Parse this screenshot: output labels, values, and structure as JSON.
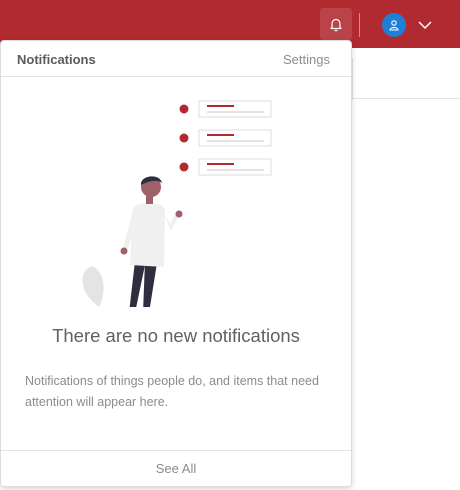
{
  "topbar": {
    "color": "#b02a30",
    "bell_icon": "bell-icon",
    "user_icon": "user-icon",
    "chevron_icon": "chevron-down-icon",
    "avatar_color": "#1f7ed6"
  },
  "notifications": {
    "title": "Notifications",
    "settings_label": "Settings",
    "empty_title": "There are no new notifications",
    "empty_description": "Notifications of things people do, and items that need attention will appear here.",
    "see_all_label": "See All",
    "illustration": "person-with-notification-list-illustration",
    "accent_color": "#b02a30"
  }
}
